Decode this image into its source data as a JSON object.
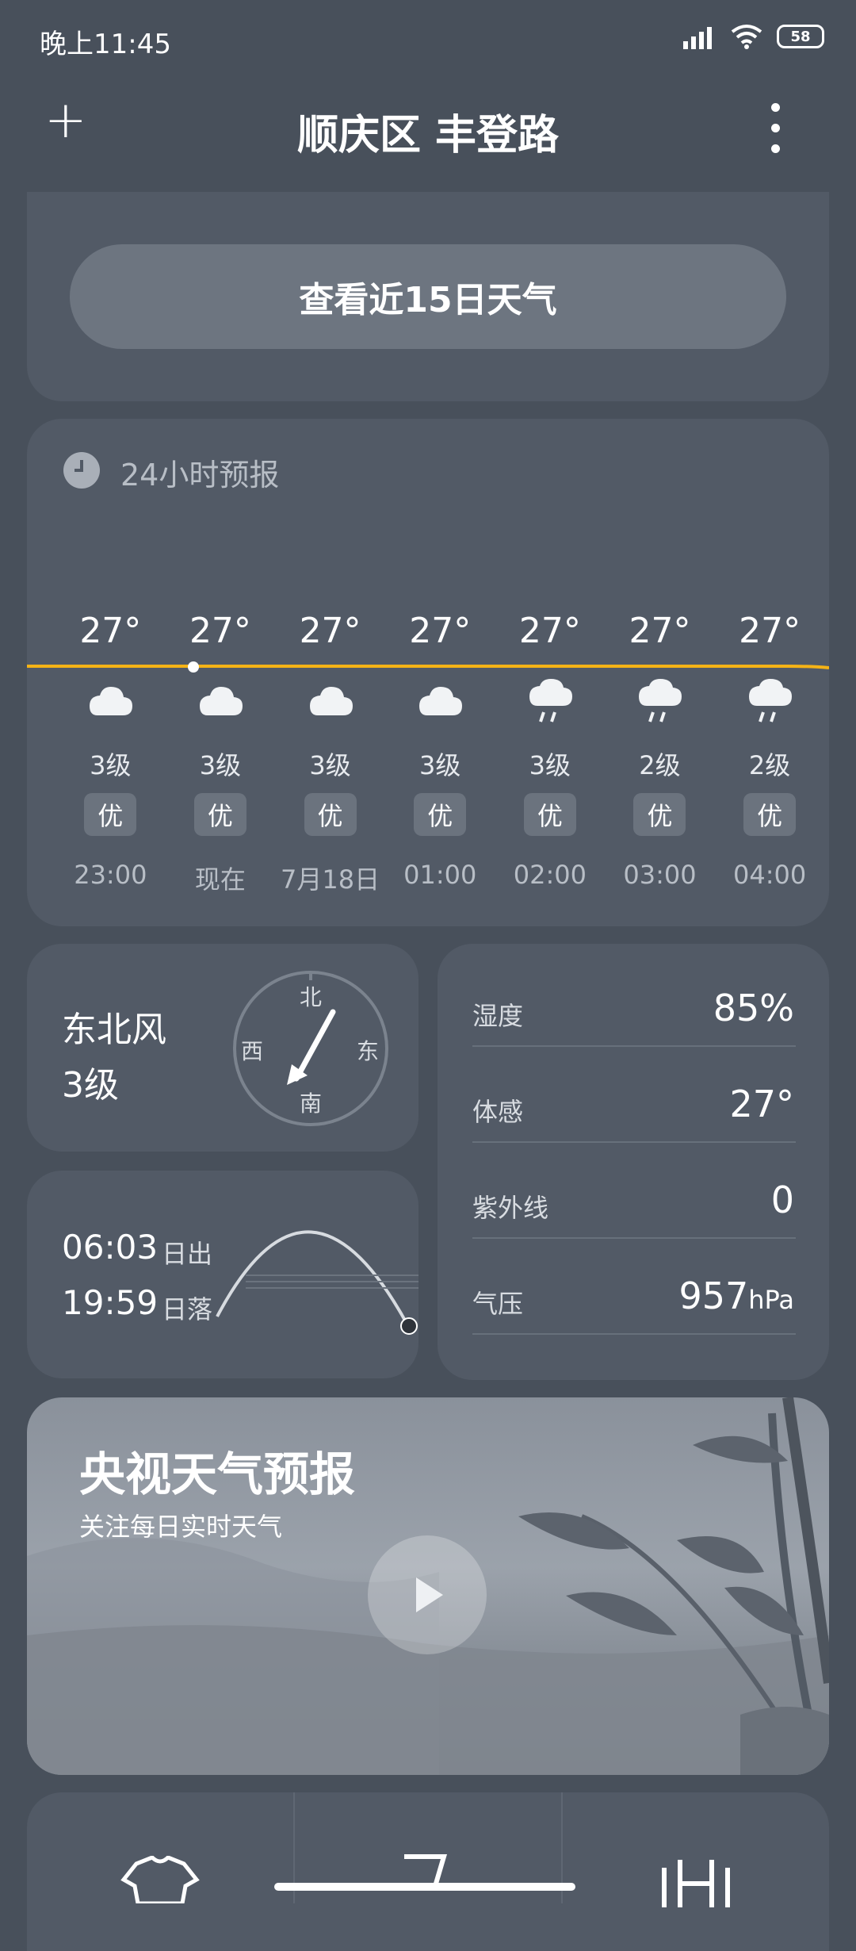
{
  "status": {
    "time": "晚上11:45",
    "battery": "58"
  },
  "header": {
    "title": "顺庆区 丰登路"
  },
  "forecast_button": "查看近15日天气",
  "hourly": {
    "title": "24小时预报",
    "items": [
      {
        "temp": "27°",
        "wind": "3级",
        "aq": "优",
        "time": "23:00",
        "icon": "cloud-icon"
      },
      {
        "temp": "27°",
        "wind": "3级",
        "aq": "优",
        "time": "现在",
        "icon": "cloud-icon"
      },
      {
        "temp": "27°",
        "wind": "3级",
        "aq": "优",
        "time": "7月18日",
        "icon": "cloud-icon"
      },
      {
        "temp": "27°",
        "wind": "3级",
        "aq": "优",
        "time": "01:00",
        "icon": "cloud-icon"
      },
      {
        "temp": "27°",
        "wind": "3级",
        "aq": "优",
        "time": "02:00",
        "icon": "rain-icon"
      },
      {
        "temp": "27°",
        "wind": "2级",
        "aq": "优",
        "time": "03:00",
        "icon": "rain-icon"
      },
      {
        "temp": "27°",
        "wind": "2级",
        "aq": "优",
        "time": "04:00",
        "icon": "rain-icon"
      }
    ]
  },
  "wind": {
    "direction": "东北风",
    "level": "3级",
    "compass": {
      "n": "北",
      "s": "南",
      "e": "东",
      "w": "西"
    }
  },
  "details": [
    {
      "label": "湿度",
      "value": "85%"
    },
    {
      "label": "体感",
      "value": "27°"
    },
    {
      "label": "紫外线",
      "value": "0"
    },
    {
      "label": "气压",
      "value": "957",
      "unit": "hPa"
    }
  ],
  "sun": {
    "sunrise": "06:03",
    "sunrise_label": "日出",
    "sunset": "19:59",
    "sunset_label": "日落"
  },
  "video": {
    "title": "央视天气预报",
    "subtitle": "关注每日实时天气"
  },
  "colors": {
    "bg": "#48505b",
    "card": "#525a66",
    "accent": "#f5b316"
  }
}
